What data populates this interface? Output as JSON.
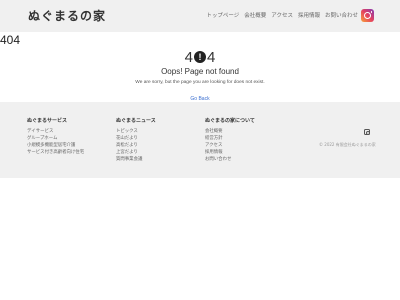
{
  "header": {
    "logo": "ぬぐまるの家",
    "nav": [
      "トップページ",
      "会社概要",
      "アクセス",
      "採用情報",
      "お問い合わせ"
    ],
    "instagram_icon": "instagram-icon"
  },
  "page": {
    "code": "404",
    "big_prefix": "4",
    "big_icon": "!",
    "big_suffix": "4",
    "title": "Oops! Page not found",
    "message": "We are sorry, but the page you are looking for does not exist.",
    "back_link": "Go Back"
  },
  "footer": {
    "columns": [
      {
        "heading": "ぬぐまるサービス",
        "items": [
          "デイサービス",
          "グループホーム",
          "小規模多機能型居宅介護",
          "サービス付き高齢者向け住宅"
        ]
      },
      {
        "heading": "ぬぐまるニュース",
        "items": [
          "トピックス",
          "花山だより",
          "高松だより",
          "上宮だより",
          "質問事業会議"
        ]
      },
      {
        "heading": "ぬぐまるの家について",
        "items": [
          "会社概要",
          "経営方針",
          "アクセス",
          "採用情報",
          "お問い合わせ"
        ]
      }
    ],
    "copyright": "© 2022 有限会社ぬぐまるの家",
    "instagram_icon": "instagram-icon"
  },
  "colors": {
    "header_bg": "#f0f0f0",
    "footer_bg": "#f0f0f0",
    "link": "#3a6ed0"
  }
}
